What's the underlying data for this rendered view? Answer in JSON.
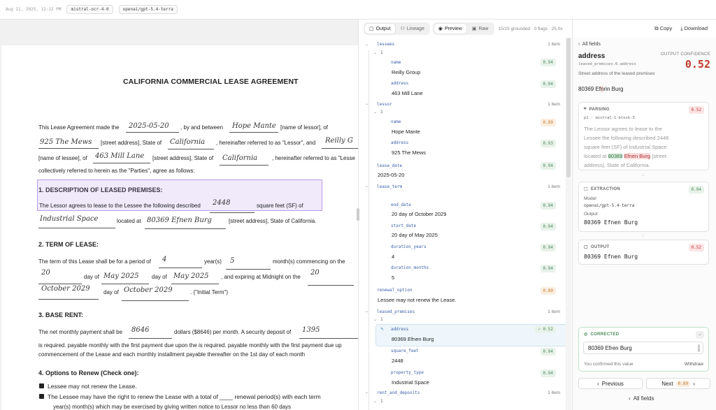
{
  "topbar": {
    "timestamp": "Aug 21, 2025, 12:22 PM",
    "model_a": "mistral-ocr-4-0",
    "model_b": "openai/gpt-5.4-terra"
  },
  "document": {
    "title": "CALIFORNIA COMMERCIAL LEASE AGREEMENT",
    "line1_a": "This Lease Agreement made the",
    "line1_b": ", by and between",
    "line1_c": "[name of lessor], of",
    "line2_a": "[street address], State of",
    "line2_b": ", hereinafter referred to as \"Lessor\", and",
    "line3_a": "[name of lessee], of",
    "line3_b": "[street address], State of",
    "line3_c": ", hereinafter referred to as \"Lesse",
    "line4": "collectively referred to herein as the \"Parties\", agree as follows:",
    "h1": "1. DESCRIPTION OF LEASED PREMISES:",
    "p1_a": "The Lessor agrees to lease to the Lessee the following described",
    "p1_b": "square feet (SF) of",
    "p1_c": "located at",
    "p1_d": "[street address], State of California.",
    "h2": "2. TERM OF LEASE:",
    "p2_a": "The term of this Lease shall be for a period of",
    "p2_b": "year(s)",
    "p2_c": "month(s) commencing on the",
    "p2_d": "day of",
    "p2_e": "day of",
    "p2_f": ", and expiring at Midnight on the",
    "p2_g": "day of",
    "p2_h": ". (\"Initial Term\")",
    "h3": "3. BASE RENT:",
    "p3_a": "The net monthly payment shall be",
    "p3_b": "dollars ($8646) per month. A security deposit of",
    "p3_c": "is required. payable monthly with the first payment due upon the is required. payable monthly with the first payment due up",
    "p3_d": "commencement of the Lease and each monthly installment payable thereafter on the 1st day of each month",
    "h4": "4. Options to Renew (Check one):",
    "opt1": "Lessee may not renew the Lease.",
    "opt2": "The Lessee may have the right to renew the Lease with a total of ____ renewal period(s) with each term",
    "opt2b": "year(s)        month(s) which may be exercised by giving written notice to Lessor no less than 60 days",
    "hw": {
      "date": "2025-05-20",
      "lessor": "Hope Mante",
      "lessor_addr": "925 The Mews",
      "lessor_state": "California",
      "lessee": "Reilly G",
      "lessee_addr": "463 Mill Lane",
      "lessee_state": "California",
      "sqft": "2448",
      "type": "Industrial Space",
      "prem_addr": "80369 Efnen Burg",
      "years": "4",
      "months": "5",
      "day1": "20",
      "month1": "May 2025",
      "month2": "May 2025",
      "day2": "20",
      "month3": "October 2029",
      "month4": "October 2029",
      "rent": "8646",
      "deposit": "1395"
    }
  },
  "middle": {
    "tab_output": "Output",
    "tab_lineage": "Lineage",
    "tab_preview": "Preview",
    "tab_raw": "Raw",
    "stats": "15/15 grounded · 0 flags · 25.0s",
    "tree": {
      "lessees": "lessees",
      "lessees_count": "1 item",
      "lessees_idx": "1",
      "name_key": "name",
      "lessee_name": "Reilly Group",
      "lessee_name_conf": "0.94",
      "address_key": "address",
      "lessee_addr": "463 Mill Lane",
      "lessee_addr_conf": "0.94",
      "lessor": "lessor",
      "lessor_count": "1 item",
      "lessor_idx": "1",
      "lessor_name": "Hope Mante",
      "lessor_name_conf": "0.89",
      "lessor_addr": "925 The Mews",
      "lessor_addr_conf": "0.93",
      "lease_date_key": "lease_date",
      "lease_date": "2025-05-20",
      "lease_date_conf": "0.94",
      "lease_term": "lease_term",
      "lease_term_count": "1 item",
      "end_date_key": "end_date",
      "end_date": "20 day of October 2029",
      "end_date_conf": "0.94",
      "start_date_key": "start_date",
      "start_date": "20 day of May 2025",
      "start_date_conf": "0.94",
      "dur_years_key": "duration_years",
      "dur_years": "4",
      "dur_years_conf": "0.94",
      "dur_months_key": "duration_months",
      "dur_months": "5",
      "dur_months_conf": "0.94",
      "renewal_key": "renewal_option",
      "renewal": "Lessee may not renew the Lease.",
      "renewal_conf": "0.89",
      "premises": "leased_premises",
      "premises_count": "1 item",
      "premises_idx": "1",
      "prem_addr": "80369 Efnen Burg",
      "prem_addr_conf": "✓ 0.52",
      "sqft_key": "square_feet",
      "sqft": "2448",
      "sqft_conf": "0.94",
      "ptype_key": "property_type",
      "ptype": "Industrial Space",
      "ptype_conf": "0.94",
      "rent": "rent_and_deposits",
      "rent_count": "1 item",
      "rent_idx": "1"
    }
  },
  "right": {
    "copy": "Copy",
    "download": "Download",
    "back": "All fields",
    "field_name": "address",
    "field_path": "leased_premises.0.address",
    "conf_label": "OUTPUT CONFIDENCE",
    "conf_value": "0.52",
    "desc": "Street address of the leased premises",
    "value_a": "80369 Ef",
    "value_b": "n",
    "value_c": "ri",
    "value_d": "n Burg",
    "parsing": {
      "label": "PARSING",
      "conf": "0.52",
      "src": "p1 · mistral-1-block-3",
      "t1": "The Lessor agrees to lease to the",
      "t2": "Lessee the following described 2448",
      "t3": "square feet (SF) of Industrial Space",
      "t4a": "located at",
      "t4b": "80369",
      "t4c": "Efnen Burg",
      "t4d": "[street",
      "t5": "address], State of California."
    },
    "extraction": {
      "label": "EXTRACTION",
      "conf": "0.94",
      "model_label": "Model",
      "model": "openai/gpt-5.4-terra",
      "out_label": "Output",
      "out": "80369 Efnen Burg"
    },
    "output": {
      "label": "OUTPUT",
      "conf": "0.52",
      "val": "80369 Efnen Burg"
    },
    "corrected": {
      "label": "CORRECTED",
      "check": "✓",
      "value": "80369 Efren Burg",
      "note": "You confirmed this value",
      "withdraw": "Withdraw"
    },
    "prev": "Previous",
    "next": "Next",
    "next_conf": "0.89",
    "all_fields": "All fields"
  }
}
